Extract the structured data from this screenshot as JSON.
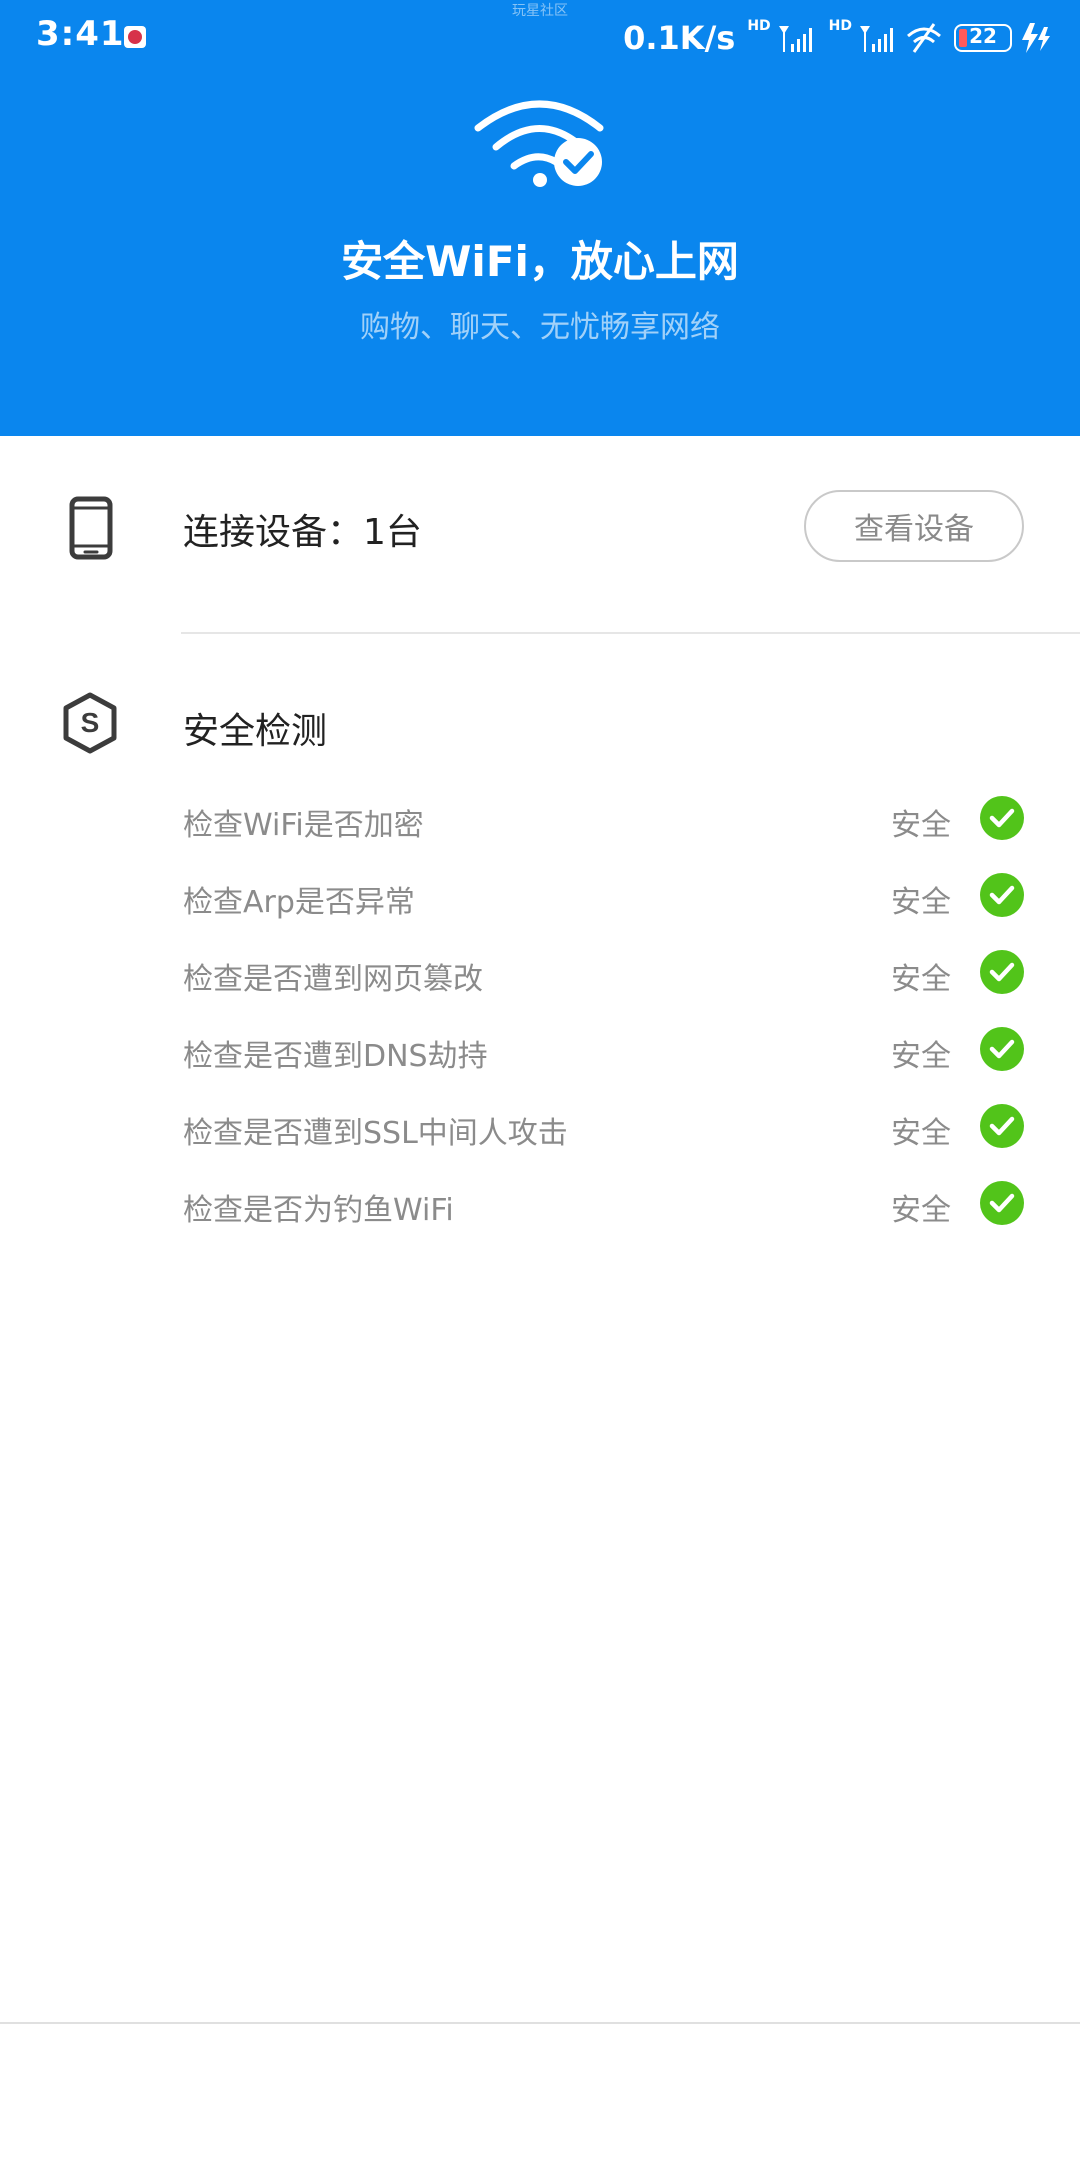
{
  "status_bar": {
    "time": "3:41",
    "watermark": "玩星社区",
    "network_speed": "0.1K/s",
    "hd_badge_1": "HD",
    "hd_badge_2": "HD",
    "battery_level": "22",
    "battery_color": "#ff5a5a"
  },
  "hero": {
    "title": "安全WiFi，放心上网",
    "subtitle": "购物、聊天、无忧畅享网络",
    "icon": "wifi-check-icon",
    "background_color": "#0a86ee"
  },
  "devices": {
    "label": "连接设备：1台",
    "button_label": "查看设备",
    "icon": "phone-icon"
  },
  "security": {
    "title": "安全检测",
    "icon": "shield-s-icon",
    "status_color": "#52c41a",
    "checks": [
      {
        "label": "检查WiFi是否加密",
        "status": "安全"
      },
      {
        "label": "检查Arp是否异常",
        "status": "安全"
      },
      {
        "label": "检查是否遭到网页篡改",
        "status": "安全"
      },
      {
        "label": "检查是否遭到DNS劫持",
        "status": "安全"
      },
      {
        "label": "检查是否遭到SSL中间人攻击",
        "status": "安全"
      },
      {
        "label": "检查是否为钓鱼WiFi",
        "status": "安全"
      }
    ]
  }
}
